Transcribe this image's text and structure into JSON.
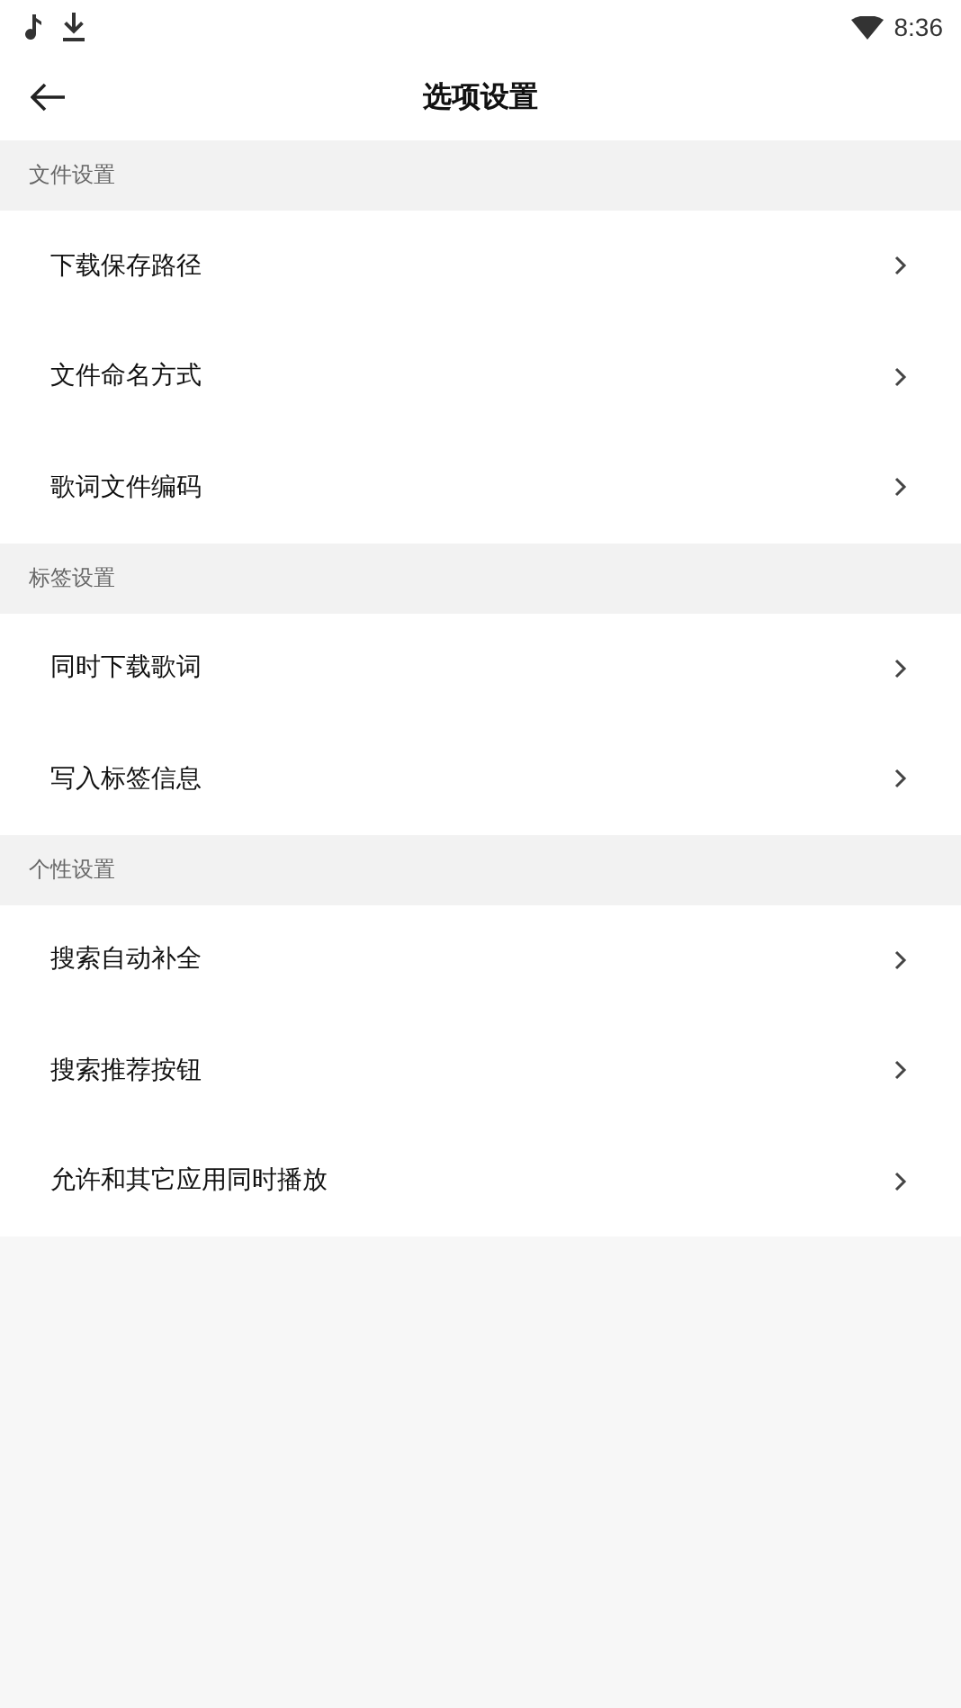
{
  "status_bar": {
    "time": "8:36"
  },
  "header": {
    "title": "选项设置"
  },
  "sections": [
    {
      "title": "文件设置",
      "items": [
        {
          "label": "下载保存路径"
        },
        {
          "label": "文件命名方式"
        },
        {
          "label": "歌词文件编码"
        }
      ]
    },
    {
      "title": "标签设置",
      "items": [
        {
          "label": "同时下载歌词"
        },
        {
          "label": "写入标签信息"
        }
      ]
    },
    {
      "title": "个性设置",
      "items": [
        {
          "label": "搜索自动补全"
        },
        {
          "label": "搜索推荐按钮"
        },
        {
          "label": "允许和其它应用同时播放"
        }
      ]
    }
  ]
}
